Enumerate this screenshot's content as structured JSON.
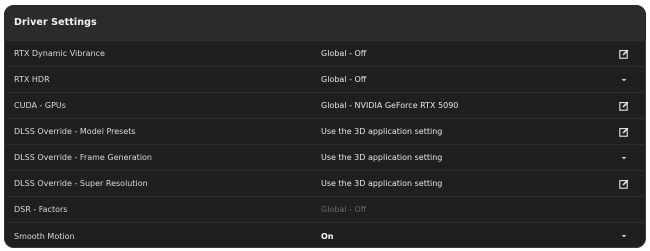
{
  "panel": {
    "title": "Driver Settings"
  },
  "settings": [
    {
      "label": "RTX Dynamic Vibrance",
      "value": "Global - Off",
      "action": "edit-icon",
      "value_state": "normal"
    },
    {
      "label": "RTX HDR",
      "value": "Global - Off",
      "action": "chevron-down-icon",
      "value_state": "normal"
    },
    {
      "label": "CUDA - GPUs",
      "value": "Global - NVIDIA GeForce RTX 5090",
      "action": "edit-icon",
      "value_state": "normal"
    },
    {
      "label": "DLSS Override - Model Presets",
      "value": "Use the 3D application setting",
      "action": "edit-icon",
      "value_state": "normal"
    },
    {
      "label": "DLSS Override - Frame Generation",
      "value": "Use the 3D application setting",
      "action": "chevron-down-icon",
      "value_state": "normal"
    },
    {
      "label": "DLSS Override - Super Resolution",
      "value": "Use the 3D application setting",
      "action": "edit-icon",
      "value_state": "normal"
    },
    {
      "label": "DSR - Factors",
      "value": "Global - Off",
      "action": "",
      "value_state": "disabled"
    },
    {
      "label": "Smooth Motion",
      "value": "On",
      "action": "chevron-down-icon",
      "value_state": "bold"
    }
  ],
  "colors": {
    "panel_bg": "#1f1f1f",
    "header_bg": "#2b2b2b",
    "text": "#d9d9d9",
    "disabled_text": "#6a6a6a"
  }
}
